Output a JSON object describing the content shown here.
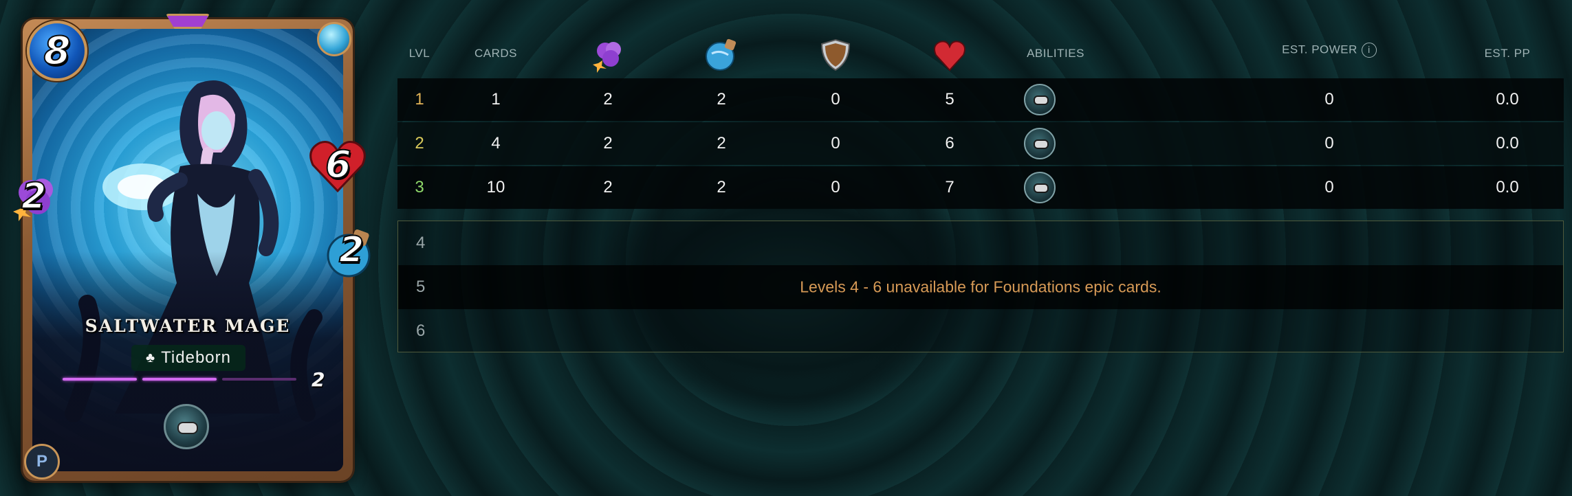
{
  "card": {
    "name": "SALTWATER MAGE",
    "mana": "8",
    "attack": "2",
    "health": "6",
    "speed": "2",
    "edition_glyph": "♣",
    "edition": "Tideborn",
    "level": "2",
    "level_bars_filled": 2,
    "level_bars_total": 3,
    "element_icon": "water-element-icon",
    "ability_icon": "ability-icon",
    "set_logo": "P",
    "colors": {
      "frame": "#c48a55",
      "mana": "#1156b8",
      "health": "#d0202a",
      "attack": "#8e3fd0",
      "level_bar": "#d36af0"
    }
  },
  "table": {
    "headers": {
      "lvl": "LVL",
      "cards": "CARDS",
      "attack_icon": "magic-attack-icon",
      "speed_icon": "speed-icon",
      "armor_icon": "armor-shield-icon",
      "health_icon": "health-heart-icon",
      "abilities": "ABILITIES",
      "est_power": "EST. POWER",
      "est_pp": "EST. PP"
    },
    "rows": [
      {
        "lvl": "1",
        "cards": "1",
        "attack": "2",
        "speed": "2",
        "armor": "0",
        "health": "5",
        "ability": "ability-icon",
        "est_power": "0",
        "est_pp": "0.0"
      },
      {
        "lvl": "2",
        "cards": "4",
        "attack": "2",
        "speed": "2",
        "armor": "0",
        "health": "6",
        "ability": "ability-icon",
        "est_power": "0",
        "est_pp": "0.0"
      },
      {
        "lvl": "3",
        "cards": "10",
        "attack": "2",
        "speed": "2",
        "armor": "0",
        "health": "7",
        "ability": "ability-icon",
        "est_power": "0",
        "est_pp": "0.0"
      }
    ],
    "locked_levels": [
      "4",
      "5",
      "6"
    ],
    "locked_message": "Levels 4 - 6 unavailable for Foundations epic cards.",
    "colors": {
      "lvl1": "#e3b458",
      "lvl2": "#d9c95b",
      "lvl3": "#8fd86a",
      "locked_message": "#d79a56"
    }
  }
}
